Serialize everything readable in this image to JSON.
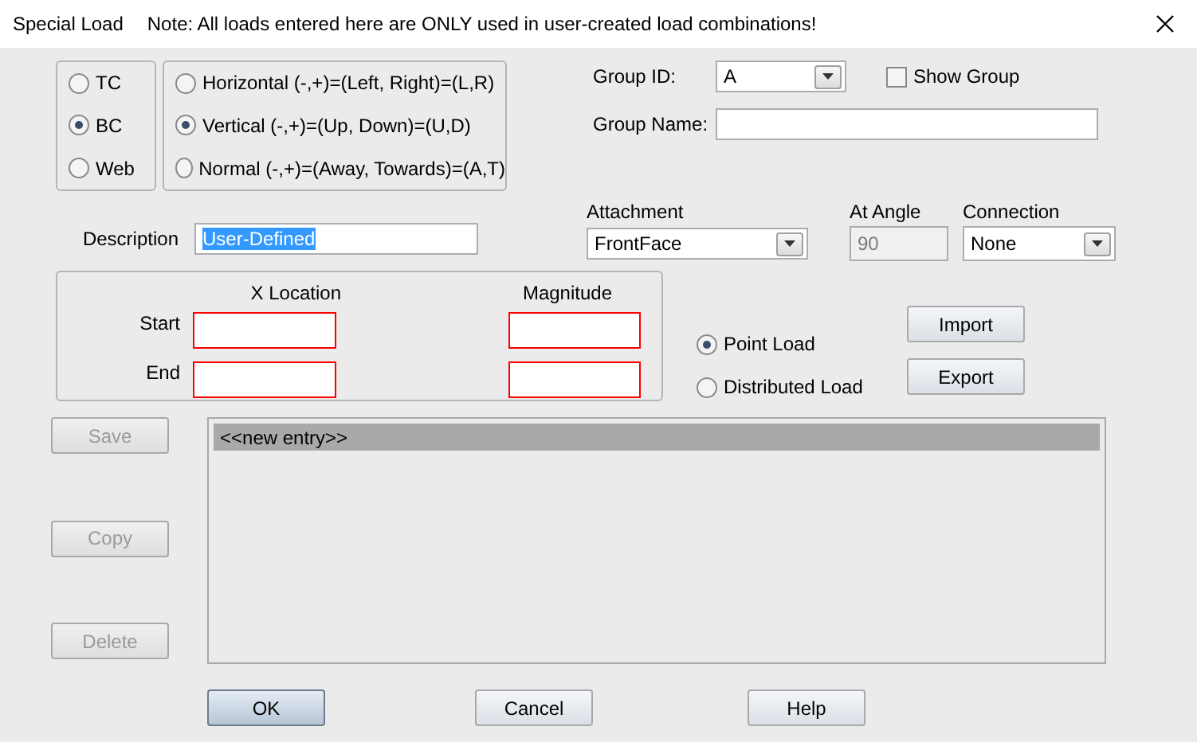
{
  "window": {
    "title": "Special Load",
    "note": "Note: All loads entered here are ONLY used in user-created load combinations!"
  },
  "member_radios": [
    {
      "label": "TC",
      "selected": false
    },
    {
      "label": "BC",
      "selected": true
    },
    {
      "label": "Web",
      "selected": false
    }
  ],
  "direction_radios": [
    {
      "label": "Horizontal (-,+)=(Left, Right)=(L,R)",
      "selected": false
    },
    {
      "label": "Vertical (-,+)=(Up, Down)=(U,D)",
      "selected": true
    },
    {
      "label": "Normal (-,+)=(Away, Towards)=(A,T)",
      "selected": false
    }
  ],
  "group_id": {
    "label": "Group ID:",
    "value": "A"
  },
  "show_group": {
    "label": "Show Group",
    "checked": false
  },
  "group_name": {
    "label": "Group Name:"
  },
  "description": {
    "label": "Description",
    "value": "User-Defined",
    "text_selected": true
  },
  "attachment": {
    "label": "Attachment",
    "value": "FrontFace"
  },
  "at_angle": {
    "label": "At Angle",
    "value": "90",
    "disabled": true
  },
  "connection": {
    "label": "Connection",
    "value": "None"
  },
  "location_table": {
    "columns": [
      "X Location",
      "Magnitude"
    ],
    "rows": [
      {
        "label": "Start",
        "invalid": true
      },
      {
        "label": "End",
        "invalid": true
      }
    ]
  },
  "load_type_radios": [
    {
      "label": "Point Load",
      "selected": true
    },
    {
      "label": "Distributed Load",
      "selected": false
    }
  ],
  "transfer_buttons": [
    {
      "label": "Import"
    },
    {
      "label": "Export"
    }
  ],
  "entry_buttons": [
    {
      "label": "Save",
      "disabled": true
    },
    {
      "label": "Copy",
      "disabled": true
    },
    {
      "label": "Delete",
      "disabled": true
    }
  ],
  "entries": [
    {
      "label": "<<new entry>>",
      "selected": true
    }
  ],
  "footer_buttons": [
    {
      "label": "OK",
      "default": true
    },
    {
      "label": "Cancel",
      "default": false
    },
    {
      "label": "Help",
      "default": false
    }
  ]
}
